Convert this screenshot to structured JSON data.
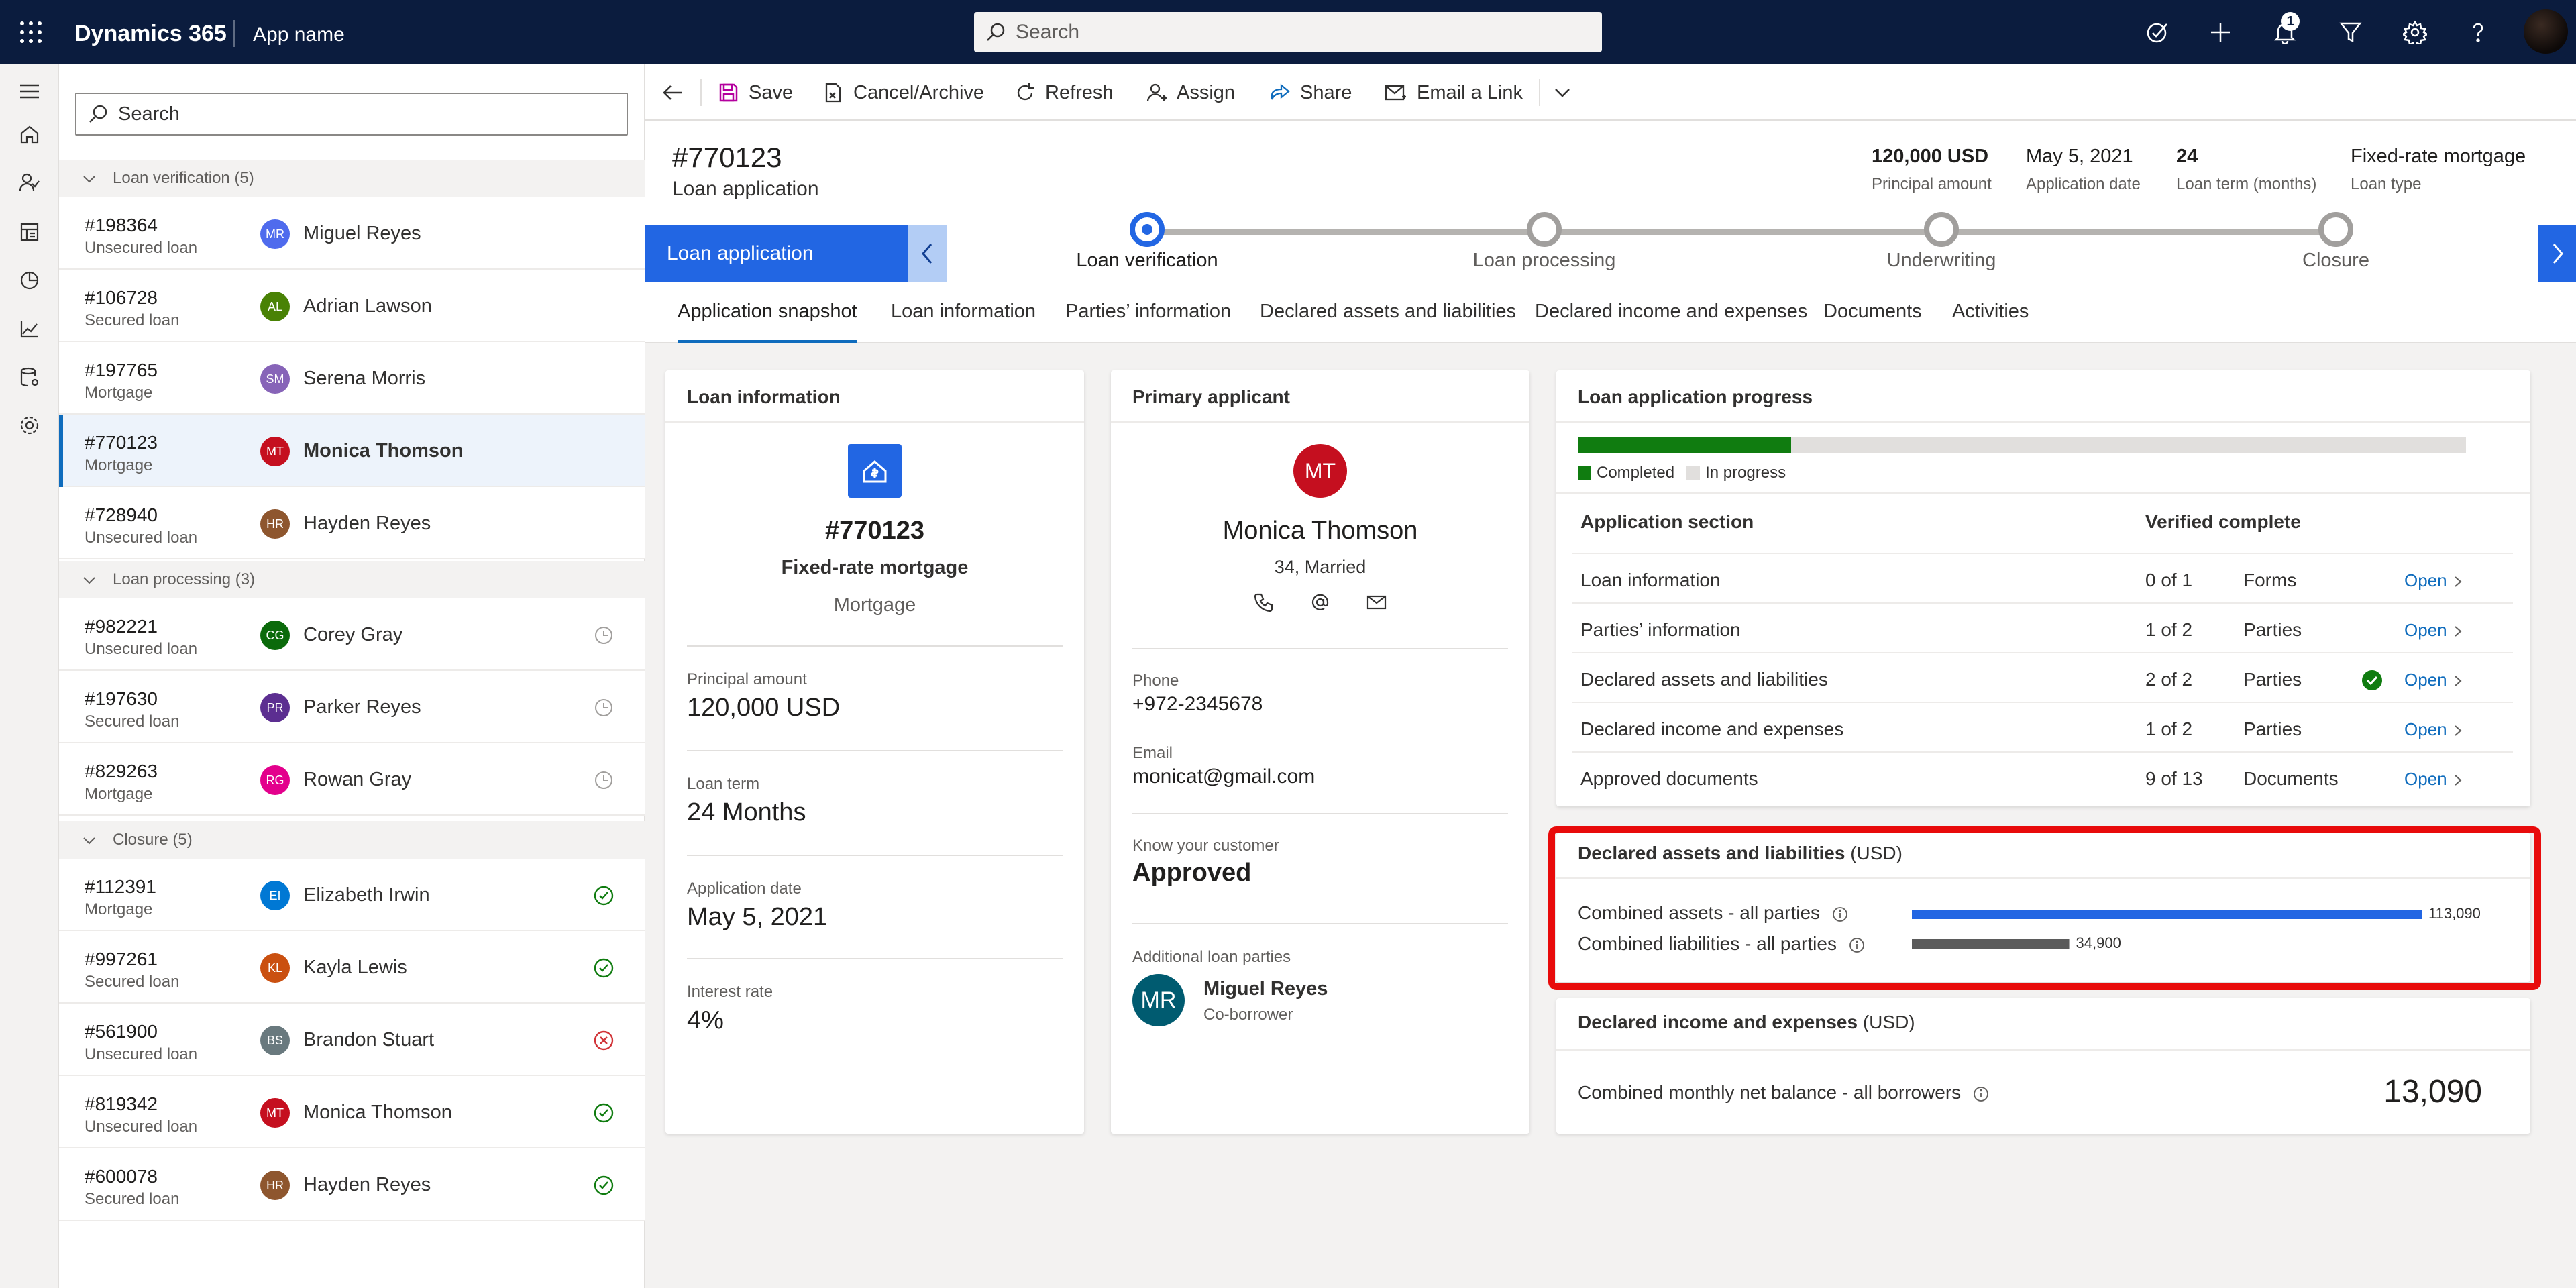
{
  "app": {
    "brand": "Dynamics 365",
    "app_name": "App name",
    "search_placeholder": "Search",
    "notification_count": "1"
  },
  "list": {
    "search_placeholder": "Search",
    "groups": [
      {
        "label": "Loan verification (5)"
      },
      {
        "label": "Loan processing (3)"
      },
      {
        "label": "Closure (5)"
      }
    ],
    "rows": [
      {
        "id": "#198364",
        "type": "Unsecured loan",
        "initials": "MR",
        "name": "Miguel Reyes",
        "avatar_color": "#4f6bed",
        "status": ""
      },
      {
        "id": "#106728",
        "type": "Secured loan",
        "initials": "AL",
        "name": "Adrian Lawson",
        "avatar_color": "#498205",
        "status": ""
      },
      {
        "id": "#197765",
        "type": "Mortgage",
        "initials": "SM",
        "name": "Serena Morris",
        "avatar_color": "#8764b8",
        "status": ""
      },
      {
        "id": "#770123",
        "type": "Mortgage",
        "initials": "MT",
        "name": "Monica Thomson",
        "avatar_color": "#c50f1f",
        "status": "",
        "selected": true
      },
      {
        "id": "#728940",
        "type": "Unsecured loan",
        "initials": "HR",
        "name": "Hayden Reyes",
        "avatar_color": "#8e562e",
        "status": ""
      },
      {
        "id": "#982221",
        "type": "Unsecured loan",
        "initials": "CG",
        "name": "Corey Gray",
        "avatar_color": "#0b6a0b",
        "status": "pending"
      },
      {
        "id": "#197630",
        "type": "Secured loan",
        "initials": "PR",
        "name": "Parker Reyes",
        "avatar_color": "#5c2e91",
        "status": "pending"
      },
      {
        "id": "#829263",
        "type": "Mortgage",
        "initials": "RG",
        "name": "Rowan Gray",
        "avatar_color": "#e3008c",
        "status": "pending"
      },
      {
        "id": "#112391",
        "type": "Mortgage",
        "initials": "EI",
        "name": "Elizabeth Irwin",
        "avatar_color": "#0078d4",
        "status": "done"
      },
      {
        "id": "#997261",
        "type": "Secured loan",
        "initials": "KL",
        "name": "Kayla Lewis",
        "avatar_color": "#ca5010",
        "status": "done"
      },
      {
        "id": "#561900",
        "type": "Unsecured loan",
        "initials": "BS",
        "name": "Brandon Stuart",
        "avatar_color": "#69797e",
        "status": "rejected"
      },
      {
        "id": "#819342",
        "type": "Unsecured loan",
        "initials": "MT",
        "name": "Monica Thomson",
        "avatar_color": "#c50f1f",
        "status": "done"
      },
      {
        "id": "#600078",
        "type": "Secured loan",
        "initials": "HR",
        "name": "Hayden Reyes",
        "avatar_color": "#8e562e",
        "status": "done"
      }
    ]
  },
  "commands": {
    "save": "Save",
    "cancel_archive": "Cancel/Archive",
    "refresh": "Refresh",
    "assign": "Assign",
    "share": "Share",
    "email_link": "Email a Link"
  },
  "record": {
    "title": "#770123",
    "entity": "Loan application",
    "header_fields": [
      {
        "value": "120,000 USD",
        "label": "Principal amount"
      },
      {
        "value": "May 5, 2021",
        "label": "Application date"
      },
      {
        "value": "24",
        "label": "Loan term (months)"
      },
      {
        "value": "Fixed-rate mortgage",
        "label": "Loan type"
      }
    ]
  },
  "bpf": {
    "current_stage_box": "Loan application",
    "stages": [
      "Loan verification",
      "Loan processing",
      "Underwriting",
      "Closure"
    ],
    "active_index": 0
  },
  "tabs": [
    "Application snapshot",
    "Loan information",
    "Parties’ information",
    "Declared assets and liabilities",
    "Declared income and expenses",
    "Documents",
    "Activities"
  ],
  "loan_info": {
    "title": "Loan information",
    "number": "#770123",
    "product": "Fixed-rate mortgage",
    "category": "Mortgage",
    "fields": [
      {
        "label": "Principal amount",
        "value": "120,000 USD"
      },
      {
        "label": "Loan term",
        "value": "24 Months"
      },
      {
        "label": "Application date",
        "value": "May 5, 2021"
      },
      {
        "label": "Interest rate",
        "value": "4%"
      }
    ]
  },
  "applicant": {
    "title": "Primary applicant",
    "initials": "MT",
    "name": "Monica Thomson",
    "details": "34, Married",
    "phone_label": "Phone",
    "phone": "+972-2345678",
    "email_label": "Email",
    "email": "monicat@gmail.com",
    "kyc_label": "Know your customer",
    "kyc": "Approved",
    "additional_label": "Additional loan parties",
    "co_initials": "MR",
    "co_name": "Miguel Reyes",
    "co_role": "Co-borrower"
  },
  "progress": {
    "title": "Loan application progress",
    "completed_fraction": 0.24,
    "legend_completed": "Completed",
    "legend_in_progress": "In progress",
    "col_section": "Application section",
    "col_verified": "Verified complete",
    "rows": [
      {
        "section": "Loan information",
        "count": "0 of 1",
        "unit": "Forms",
        "verified": false,
        "link": "Open"
      },
      {
        "section": "Parties’ information",
        "count": "1 of 2",
        "unit": "Parties",
        "verified": false,
        "link": "Open"
      },
      {
        "section": "Declared assets and liabilities",
        "count": "2 of 2",
        "unit": "Parties",
        "verified": true,
        "link": "Open"
      },
      {
        "section": "Declared income and expenses",
        "count": "1 of 2",
        "unit": "Parties",
        "verified": false,
        "link": "Open"
      },
      {
        "section": "Approved documents",
        "count": "9 of 13",
        "unit": "Documents",
        "verified": false,
        "link": "Open"
      }
    ]
  },
  "assets": {
    "title": "Declared assets and liabilities",
    "unit": "(USD)",
    "chart_data": {
      "type": "bar",
      "categories": [
        "Combined assets - all parties",
        "Combined liabilities - all parties"
      ],
      "values": [
        113090,
        34900
      ],
      "value_labels": [
        "113,090",
        "34,900"
      ],
      "colors": [
        "#2266e3",
        "#5b5b5b"
      ],
      "xlim": [
        0,
        113090
      ]
    }
  },
  "income": {
    "title": "Declared income and expenses",
    "unit": "(USD)",
    "label": "Combined monthly net balance - all borrowers",
    "value": "13,090"
  }
}
